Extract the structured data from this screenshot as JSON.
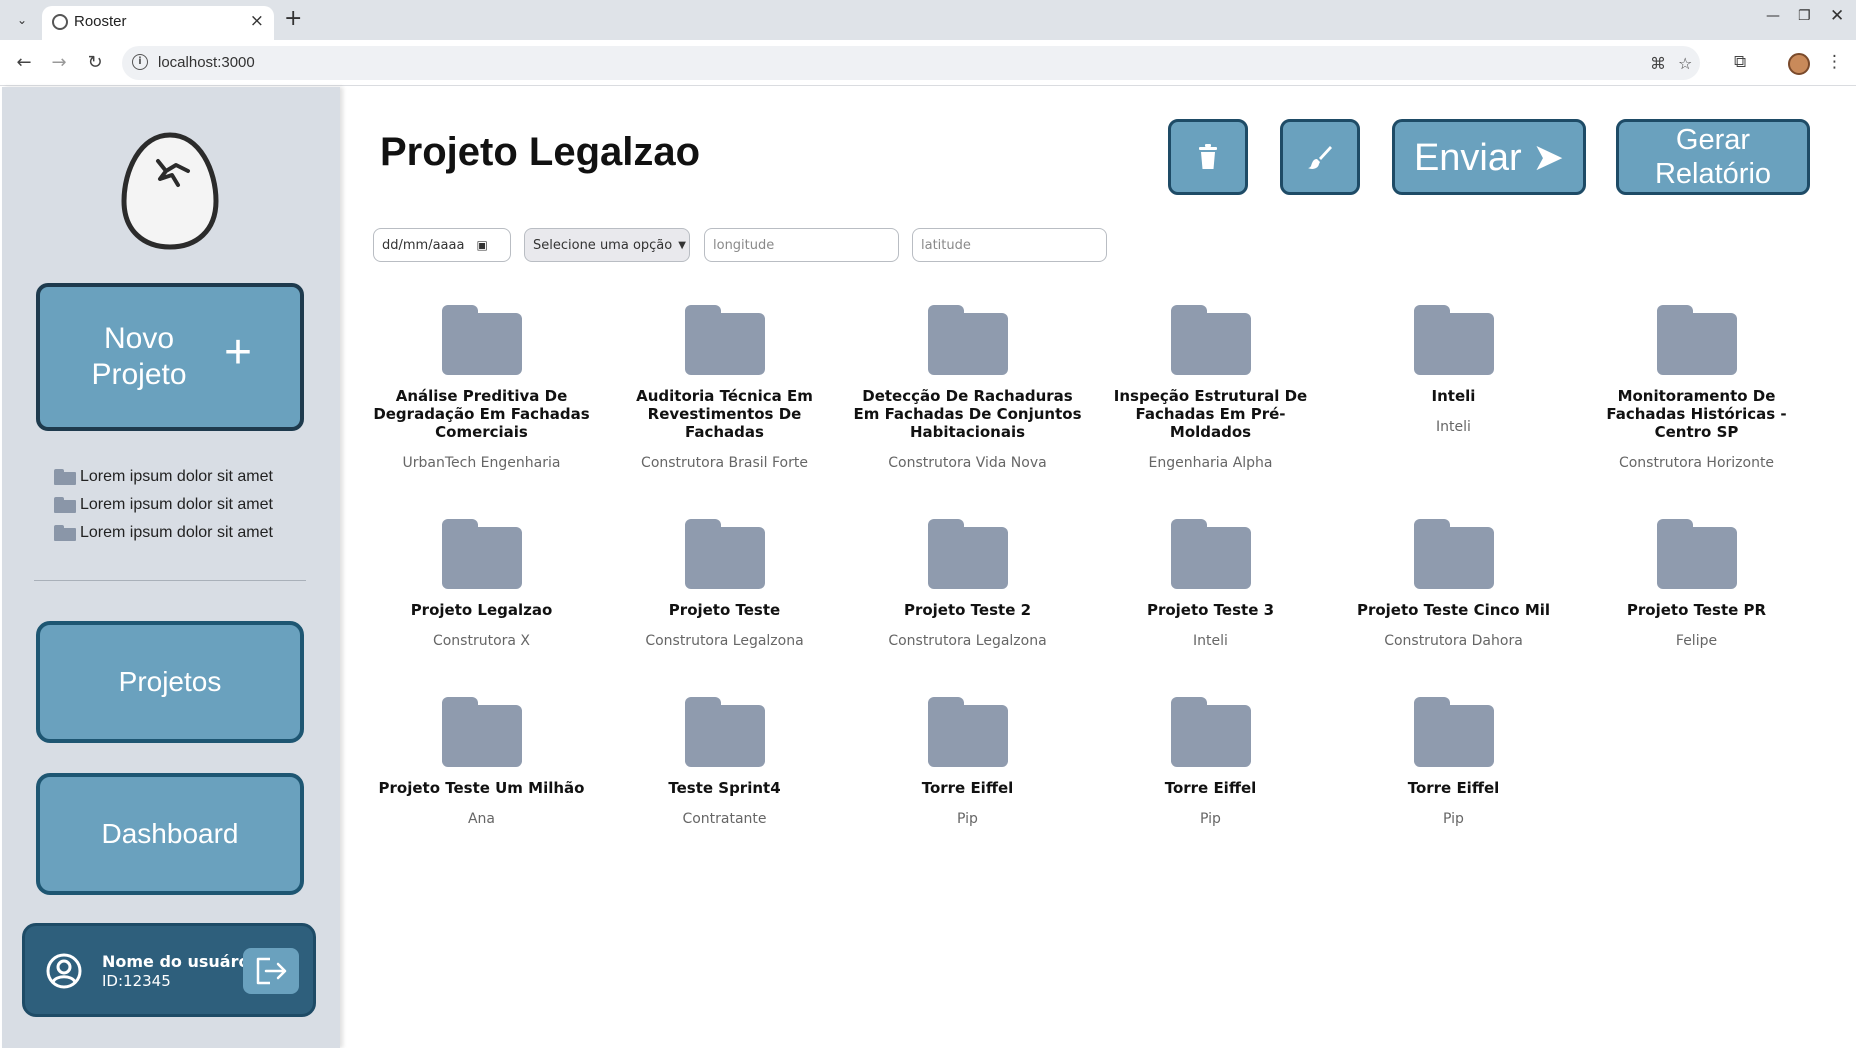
{
  "browser": {
    "tab_title": "Rooster",
    "url": "localhost:3000"
  },
  "sidebar": {
    "new_project_label": "Novo Projeto",
    "new_project_plus": "+",
    "recent_items": [
      {
        "label": "Lorem ipsum dolor sit amet"
      },
      {
        "label": "Lorem ipsum dolor sit amet"
      },
      {
        "label": "Lorem ipsum dolor sit amet"
      }
    ],
    "nav": {
      "projects_label": "Projetos",
      "dashboard_label": "Dashboard"
    },
    "user": {
      "name": "Nome do usuáro",
      "id": "ID:12345"
    }
  },
  "main": {
    "title": "Projeto Legalzao",
    "actions": {
      "send_label": "Enviar ➤",
      "report_label": "Gerar Relatório"
    },
    "filters": {
      "date_placeholder": "dd/mm/aaaa",
      "select_value": "Selecione uma opção",
      "longitude_placeholder": "longitude",
      "latitude_placeholder": "latitude"
    },
    "folders": [
      {
        "name": "Análise Preditiva De Degradação Em Fachadas Comerciais",
        "company": "UrbanTech Engenharia"
      },
      {
        "name": "Auditoria Técnica Em Revestimentos De Fachadas",
        "company": "Construtora Brasil Forte"
      },
      {
        "name": "Detecção De Rachaduras Em Fachadas De Conjuntos Habitacionais",
        "company": "Construtora Vida Nova"
      },
      {
        "name": "Inspeção Estrutural De Fachadas Em Pré-Moldados",
        "company": "Engenharia Alpha"
      },
      {
        "name": "Inteli",
        "company": "Inteli"
      },
      {
        "name": "Monitoramento De Fachadas Históricas - Centro SP",
        "company": "Construtora Horizonte"
      },
      {
        "name": "Projeto Legalzao",
        "company": "Construtora X"
      },
      {
        "name": "Projeto Teste",
        "company": "Construtora Legalzona"
      },
      {
        "name": "Projeto Teste 2",
        "company": "Construtora Legalzona"
      },
      {
        "name": "Projeto Teste 3",
        "company": "Inteli"
      },
      {
        "name": "Projeto Teste Cinco Mil",
        "company": "Construtora Dahora"
      },
      {
        "name": "Projeto Teste PR",
        "company": "Felipe"
      },
      {
        "name": "Projeto Teste Um Milhão",
        "company": "Ana"
      },
      {
        "name": "Teste Sprint4",
        "company": "Contratante"
      },
      {
        "name": "Torre Eiffel",
        "company": "Pip"
      },
      {
        "name": "Torre Eiffel",
        "company": "Pip"
      },
      {
        "name": "Torre Eiffel",
        "company": "Pip"
      }
    ]
  },
  "colors": {
    "accent": "#6aa1be",
    "accent_dark": "#1e4b66",
    "sidebar_bg": "#d8dde4",
    "folder": "#8f9bae"
  }
}
